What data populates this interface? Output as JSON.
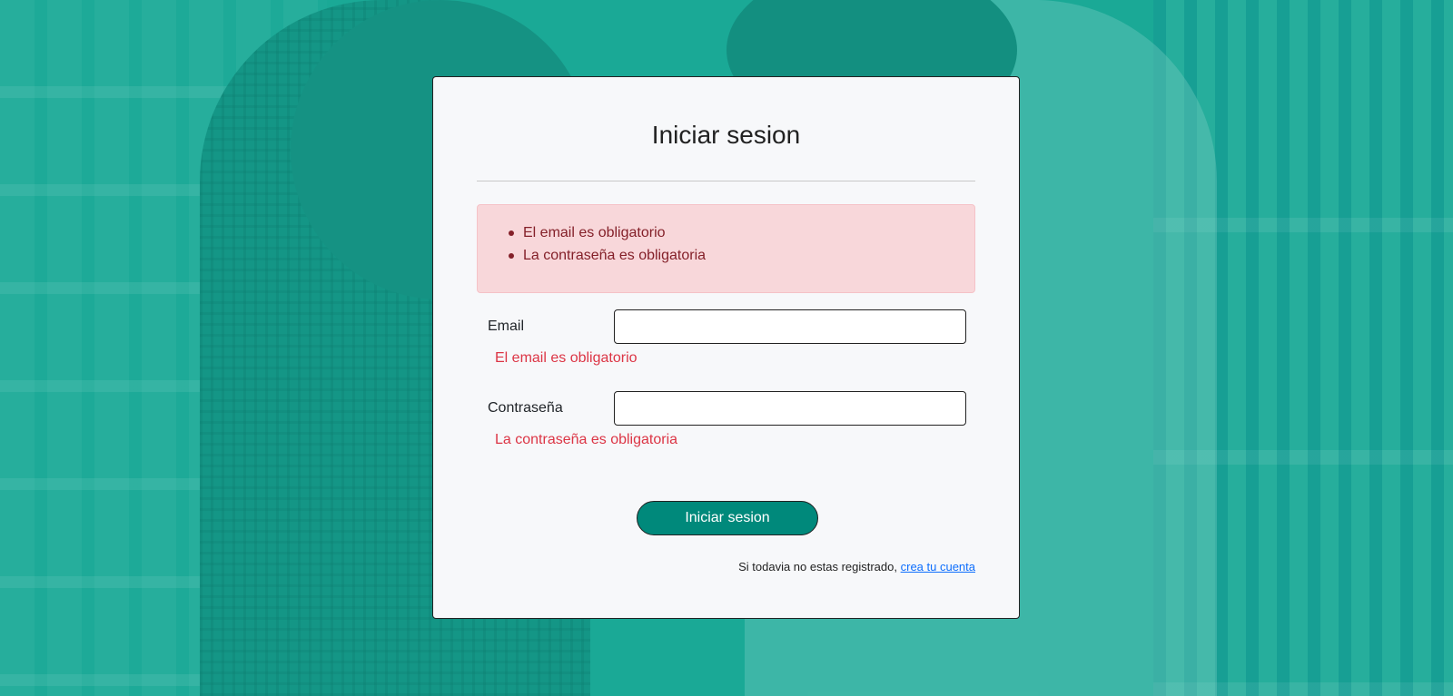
{
  "login": {
    "title": "Iniciar sesion",
    "alert_errors": [
      "El email es obligatorio",
      "La contraseña es obligatoria"
    ],
    "email": {
      "label": "Email",
      "value": "",
      "error": "El email es obligatorio"
    },
    "password": {
      "label": "Contraseña",
      "value": "",
      "error": "La contraseña es obligatoria"
    },
    "submit_label": "Iniciar sesion",
    "register_prompt": "Si todavia no estas registrado, ",
    "register_link": "crea tu cuenta"
  },
  "colors": {
    "accent": "#00897b",
    "alert_bg": "#f8d7da",
    "alert_text": "#842029",
    "error_text": "#dc3545",
    "link": "#0d6efd",
    "background_tint": "#1ba99a"
  }
}
